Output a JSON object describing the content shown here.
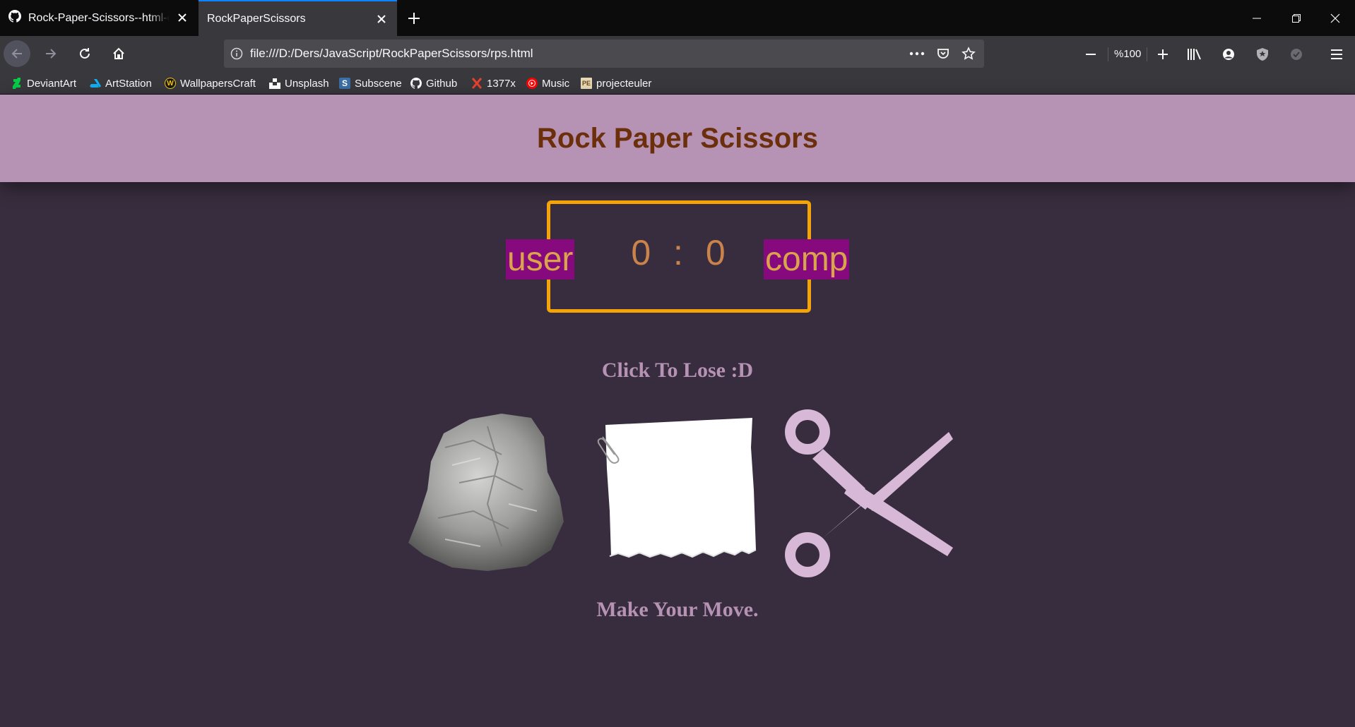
{
  "browser": {
    "tabs": [
      {
        "title": "Rock-Paper-Scissors--html-css-js",
        "icon": "github-icon",
        "active": false
      },
      {
        "title": "RockPaperScissors",
        "icon": "",
        "active": true
      }
    ],
    "url": "file:///D:/Ders/JavaScript/RockPaperScissors/rps.html",
    "zoom": "%100",
    "bookmarks": [
      {
        "label": "DeviantArt",
        "icon": "deviantart-icon",
        "color": "#05cc47"
      },
      {
        "label": "ArtStation",
        "icon": "artstation-icon",
        "color": "#13aff0"
      },
      {
        "label": "WallpapersCraft",
        "icon": "wallpaperscraft-icon",
        "color": "#f5c518"
      },
      {
        "label": "Unsplash",
        "icon": "unsplash-icon",
        "color": "#ffffff"
      },
      {
        "label": "Subscene",
        "icon": "subscene-icon",
        "color": "#3b6ea5"
      },
      {
        "label": "Github",
        "icon": "github-icon",
        "color": "#ffffff"
      },
      {
        "label": "1377x",
        "icon": "1377x-icon",
        "color": "#e8412c"
      },
      {
        "label": "Music",
        "icon": "youtube-music-icon",
        "color": "#ff0000"
      },
      {
        "label": "projecteuler",
        "icon": "projecteuler-icon",
        "color": "#c8a66b"
      }
    ]
  },
  "page": {
    "title": "Rock Paper Scissors",
    "score": {
      "user_label": "user",
      "comp_label": "comp",
      "user_score": "0",
      "comp_score": "0",
      "separator": ":"
    },
    "result_message": "Click To Lose :D",
    "choices": [
      {
        "name": "rock",
        "icon": "rock-icon"
      },
      {
        "name": "paper",
        "icon": "paper-icon"
      },
      {
        "name": "scissors",
        "icon": "scissors-icon"
      }
    ],
    "action_message": "Make Your Move."
  },
  "colors": {
    "page_bg": "#382d3e",
    "header_bg": "#b692b4",
    "title_color": "#6b2f0b",
    "scoreboard_border": "#f5a407",
    "badge_bg": "#860a7d",
    "badge_text": "#d9a44b",
    "score_text": "#ca834b",
    "message_color": "#b692b4",
    "scissors_color": "#d7b8d6"
  }
}
